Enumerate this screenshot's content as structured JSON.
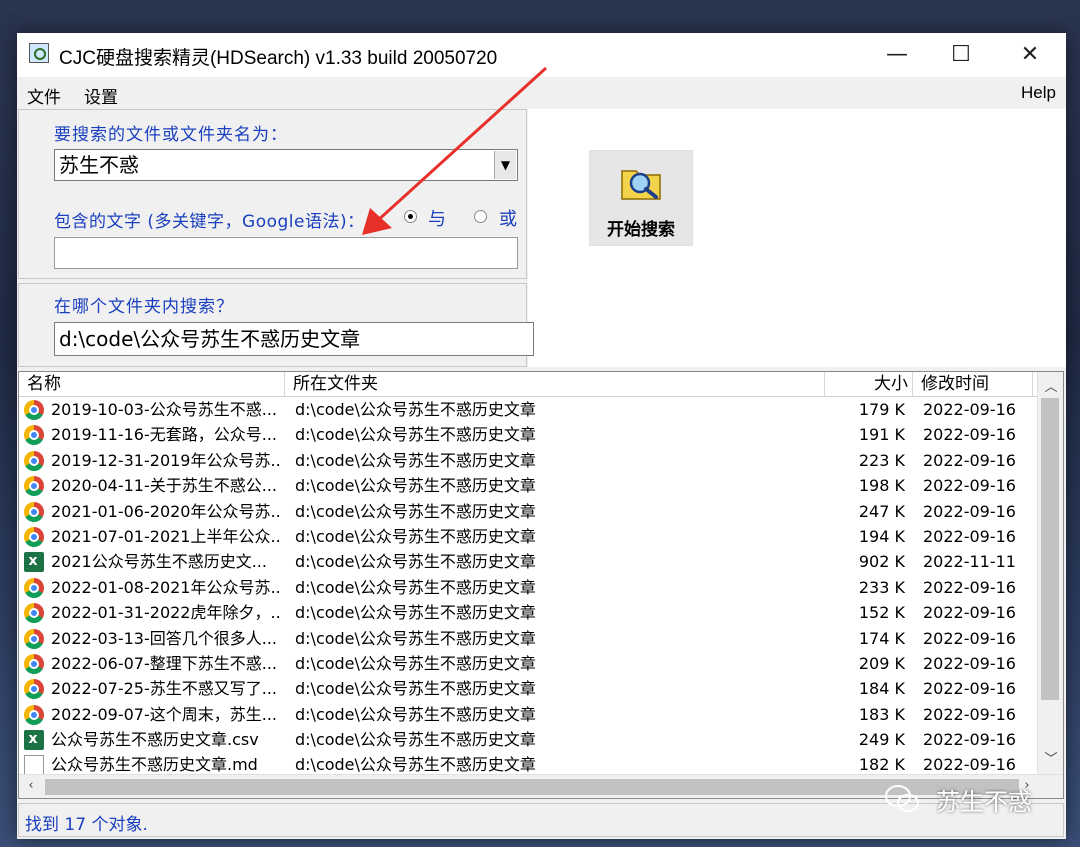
{
  "window": {
    "title": "CJC硬盘搜索精灵(HDSearch) v1.33 build 20050720",
    "minimize": "—",
    "maximize": "☐",
    "close": "✕"
  },
  "menu": {
    "file": "文件",
    "settings": "设置",
    "help": "Help"
  },
  "search": {
    "name_label": "要搜索的文件或文件夹名为：",
    "name_value": "苏生不惑",
    "text_label": "包含的文字 (多关键字，Google语法)：",
    "radio_and": "与",
    "radio_or": "或",
    "radio_selected": "and",
    "text_value": "",
    "folder_label": "在哪个文件夹内搜索？",
    "folder_value": "d:\\code\\公众号苏生不惑历史文章",
    "button_label": "开始搜索"
  },
  "list": {
    "columns": [
      "名称",
      "所在文件夹",
      "大小",
      "修改时间"
    ],
    "rows": [
      {
        "icon": "chrome-icon",
        "name": "2019-10-03-公众号苏生不惑...",
        "folder": "d:\\code\\公众号苏生不惑历史文章",
        "size": "179 K",
        "date": "2022-09-16"
      },
      {
        "icon": "chrome-icon",
        "name": "2019-11-16-无套路，公众号...",
        "folder": "d:\\code\\公众号苏生不惑历史文章",
        "size": "191 K",
        "date": "2022-09-16"
      },
      {
        "icon": "chrome-icon",
        "name": "2019-12-31-2019年公众号苏...",
        "folder": "d:\\code\\公众号苏生不惑历史文章",
        "size": "223 K",
        "date": "2022-09-16"
      },
      {
        "icon": "chrome-icon",
        "name": "2020-04-11-关于苏生不惑公...",
        "folder": "d:\\code\\公众号苏生不惑历史文章",
        "size": "198 K",
        "date": "2022-09-16"
      },
      {
        "icon": "chrome-icon",
        "name": "2021-01-06-2020年公众号苏...",
        "folder": "d:\\code\\公众号苏生不惑历史文章",
        "size": "247 K",
        "date": "2022-09-16"
      },
      {
        "icon": "chrome-icon",
        "name": "2021-07-01-2021上半年公众...",
        "folder": "d:\\code\\公众号苏生不惑历史文章",
        "size": "194 K",
        "date": "2022-09-16"
      },
      {
        "icon": "excel-icon",
        "name": "2021公众号苏生不惑历史文...",
        "folder": "d:\\code\\公众号苏生不惑历史文章",
        "size": "902 K",
        "date": "2022-11-11"
      },
      {
        "icon": "chrome-icon",
        "name": "2022-01-08-2021年公众号苏...",
        "folder": "d:\\code\\公众号苏生不惑历史文章",
        "size": "233 K",
        "date": "2022-09-16"
      },
      {
        "icon": "chrome-icon",
        "name": "2022-01-31-2022虎年除夕，...",
        "folder": "d:\\code\\公众号苏生不惑历史文章",
        "size": "152 K",
        "date": "2022-09-16"
      },
      {
        "icon": "chrome-icon",
        "name": "2022-03-13-回答几个很多人...",
        "folder": "d:\\code\\公众号苏生不惑历史文章",
        "size": "174 K",
        "date": "2022-09-16"
      },
      {
        "icon": "chrome-icon",
        "name": "2022-06-07-整理下苏生不惑...",
        "folder": "d:\\code\\公众号苏生不惑历史文章",
        "size": "209 K",
        "date": "2022-09-16"
      },
      {
        "icon": "chrome-icon",
        "name": "2022-07-25-苏生不惑又写了...",
        "folder": "d:\\code\\公众号苏生不惑历史文章",
        "size": "184 K",
        "date": "2022-09-16"
      },
      {
        "icon": "chrome-icon",
        "name": "2022-09-07-这个周末，苏生...",
        "folder": "d:\\code\\公众号苏生不惑历史文章",
        "size": "183 K",
        "date": "2022-09-16"
      },
      {
        "icon": "excel-icon",
        "name": "公众号苏生不惑历史文章.csv",
        "folder": "d:\\code\\公众号苏生不惑历史文章",
        "size": "249 K",
        "date": "2022-09-16"
      },
      {
        "icon": "doc-icon",
        "name": "公众号苏生不惑历史文章.md",
        "folder": "d:\\code\\公众号苏生不惑历史文章",
        "size": "182 K",
        "date": "2022-09-16"
      }
    ]
  },
  "status": {
    "text": "找到 17 个对象."
  },
  "watermark": {
    "text": "苏生不惑"
  },
  "colors": {
    "label_blue": "#1a3fbf",
    "arrow_red": "#e8302a"
  }
}
